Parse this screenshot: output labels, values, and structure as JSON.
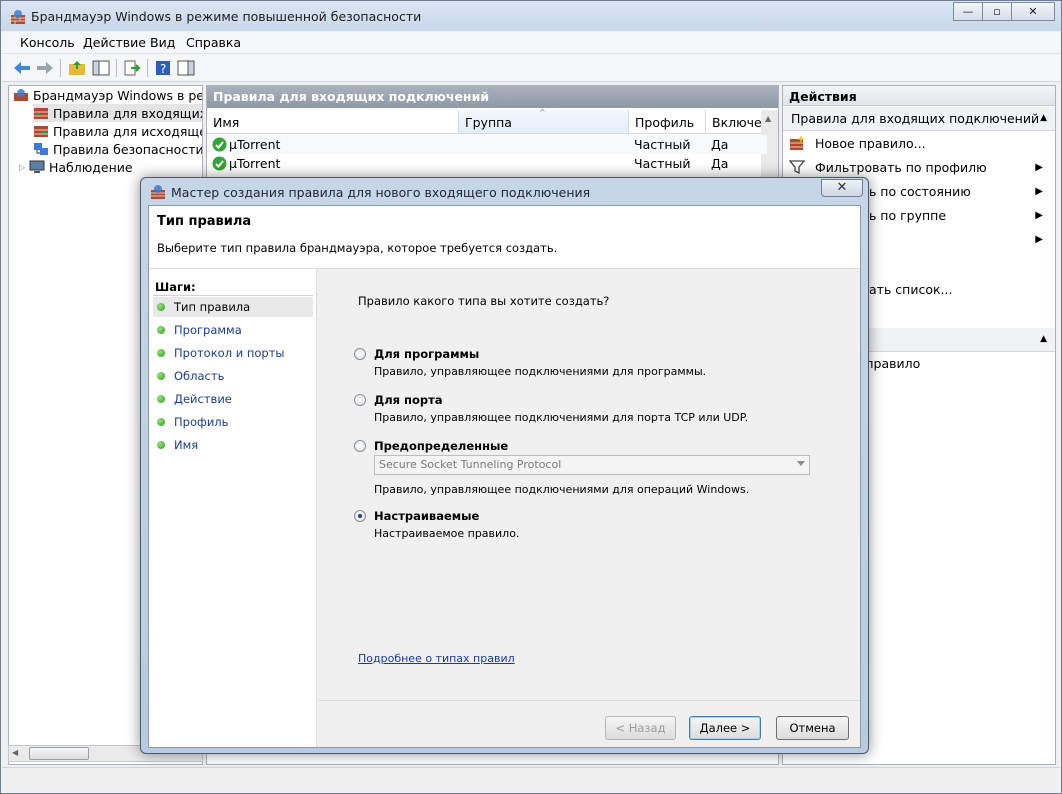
{
  "window": {
    "title": "Брандмауэр Windows в режиме повышенной безопасности",
    "controls": {
      "minimize": "—",
      "restore": "▫",
      "close": "✕"
    }
  },
  "menu": [
    "Консоль",
    "Действие",
    "Вид",
    "Справка"
  ],
  "tree": {
    "root": "Брандмауэр Windows в режим",
    "items": [
      "Правила для входящих по,",
      "Правила для исходящего п",
      "Правила безопасности по,",
      "Наблюдение"
    ]
  },
  "center": {
    "header": "Правила для входящих подключений",
    "columns": [
      "Имя",
      "Группа",
      "Профиль",
      "Включен"
    ],
    "rows": [
      {
        "name": "µTorrent",
        "group": "",
        "profile": "Частный",
        "enabled": "Да"
      },
      {
        "name": "µTorrent",
        "group": "",
        "profile": "Частный",
        "enabled": "Да"
      }
    ]
  },
  "actions": {
    "header": "Действия",
    "section1": "Правила для входящих подключений",
    "items": [
      "Новое правило...",
      "Фильтровать по профилю",
      "ать по состоянию",
      "ать по группе",
      "",
      "овать список...",
      "ь правило"
    ]
  },
  "dialog": {
    "title": "Мастер создания правила для нового входящего подключения",
    "close": "✕",
    "heading": "Тип правила",
    "subheading": "Выберите тип правила брандмауэра, которое требуется создать.",
    "steps_label": "Шаги:",
    "steps": [
      "Тип правила",
      "Программа",
      "Протокол и порты",
      "Область",
      "Действие",
      "Профиль",
      "Имя"
    ],
    "question": "Правило какого типа вы хотите создать?",
    "options": [
      {
        "label": "Для программы",
        "desc": "Правило, управляющее подключениями для программы."
      },
      {
        "label": "Для порта",
        "desc": "Правило, управляющее подключениями для порта TCP или UDP."
      },
      {
        "label": "Предопределенные",
        "desc": "Правило, управляющее подключениями для операций Windows."
      },
      {
        "label": "Настраиваемые",
        "desc": "Настраиваемое правило."
      }
    ],
    "selected_option": "Настраиваемые",
    "predefined_combo": "Secure Socket Tunneling Protocol",
    "link": "Подробнее о типах правил",
    "buttons": {
      "back": "< Назад",
      "next": "Далее >",
      "cancel": "Отмена"
    }
  },
  "colors": {
    "accent_link": "#1a3c9f",
    "step_dot": "#2c9c21",
    "pane_header": "#8f99a5"
  }
}
